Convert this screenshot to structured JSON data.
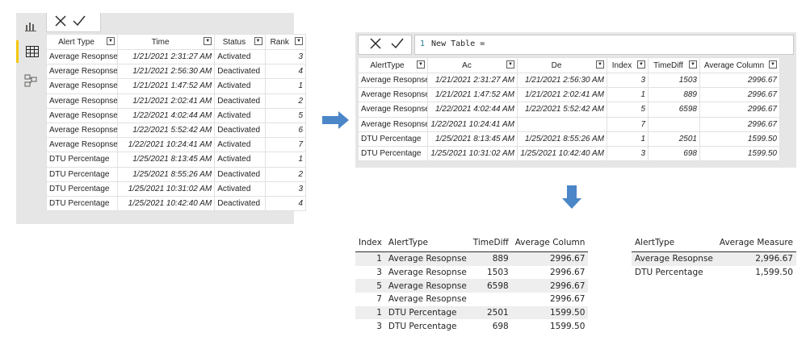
{
  "panel1": {
    "rail_icons": [
      "report-view-icon",
      "data-view-icon",
      "model-view-icon"
    ],
    "table": {
      "columns": [
        "Alert Type",
        "Time",
        "Status",
        "Rank"
      ],
      "rows": [
        [
          "Average Resopnse",
          "1/21/2021 2:31:27 AM",
          "Activated",
          "3"
        ],
        [
          "Average Resopnse",
          "1/21/2021 2:56:30 AM",
          "Deactivated",
          "4"
        ],
        [
          "Average Resopnse",
          "1/21/2021 1:47:52 AM",
          "Activated",
          "1"
        ],
        [
          "Average Resopnse",
          "1/21/2021 2:02:41 AM",
          "Deactivated",
          "2"
        ],
        [
          "Average Resopnse",
          "1/22/2021 4:02:44 AM",
          "Activated",
          "5"
        ],
        [
          "Average Resopnse",
          "1/22/2021 5:52:42 AM",
          "Deactivated",
          "6"
        ],
        [
          "Average Resopnse",
          "1/22/2021 10:24:41 AM",
          "Activated",
          "7"
        ],
        [
          "DTU Percentage",
          "1/25/2021 8:13:45 AM",
          "Activated",
          "1"
        ],
        [
          "DTU Percentage",
          "1/25/2021 8:55:26 AM",
          "Deactivated",
          "2"
        ],
        [
          "DTU Percentage",
          "1/25/2021 10:31:02 AM",
          "Activated",
          "3"
        ],
        [
          "DTU Percentage",
          "1/25/2021 10:42:40 AM",
          "Deactivated",
          "4"
        ]
      ]
    }
  },
  "panel2": {
    "formula": {
      "line_number": "1",
      "text": "New Table ="
    },
    "table": {
      "columns": [
        "AlertType",
        "Ac",
        "De",
        "Index",
        "TimeDiff",
        "Average Column"
      ],
      "rows": [
        [
          "Average Resopnse",
          "1/21/2021 2:31:27 AM",
          "1/21/2021 2:56:30 AM",
          "3",
          "1503",
          "2996.67"
        ],
        [
          "Average Resopnse",
          "1/21/2021 1:47:52 AM",
          "1/21/2021 2:02:41 AM",
          "1",
          "889",
          "2996.67"
        ],
        [
          "Average Resopnse",
          "1/22/2021 4:02:44 AM",
          "1/22/2021 5:52:42 AM",
          "5",
          "6598",
          "2996.67"
        ],
        [
          "Average Resopnse",
          "1/22/2021 10:24:41 AM",
          "",
          "7",
          "",
          "2996.67"
        ],
        [
          "DTU Percentage",
          "1/25/2021 8:13:45 AM",
          "1/25/2021 8:55:26 AM",
          "1",
          "2501",
          "1599.50"
        ],
        [
          "DTU Percentage",
          "1/25/2021 10:31:02 AM",
          "1/25/2021 10:42:40 AM",
          "3",
          "698",
          "1599.50"
        ]
      ]
    }
  },
  "visual_table1": {
    "columns": [
      "Index",
      "AlertType",
      "TimeDiff",
      "Average Column"
    ],
    "rows": [
      [
        "1",
        "Average Resopnse",
        "889",
        "2996.67"
      ],
      [
        "3",
        "Average Resopnse",
        "1503",
        "2996.67"
      ],
      [
        "5",
        "Average Resopnse",
        "6598",
        "2996.67"
      ],
      [
        "7",
        "Average Resopnse",
        "",
        "2996.67"
      ],
      [
        "1",
        "DTU Percentage",
        "2501",
        "1599.50"
      ],
      [
        "3",
        "DTU Percentage",
        "698",
        "1599.50"
      ]
    ]
  },
  "visual_table2": {
    "columns": [
      "AlertType",
      "Average Measure"
    ],
    "rows": [
      [
        "Average Resopnse",
        "2,996.67"
      ],
      [
        "DTU Percentage",
        "1,599.50"
      ]
    ]
  },
  "colors": {
    "arrow": "#4a86c8",
    "active_rail": "#f2c811",
    "panel_bg": "#e6e6e6"
  }
}
